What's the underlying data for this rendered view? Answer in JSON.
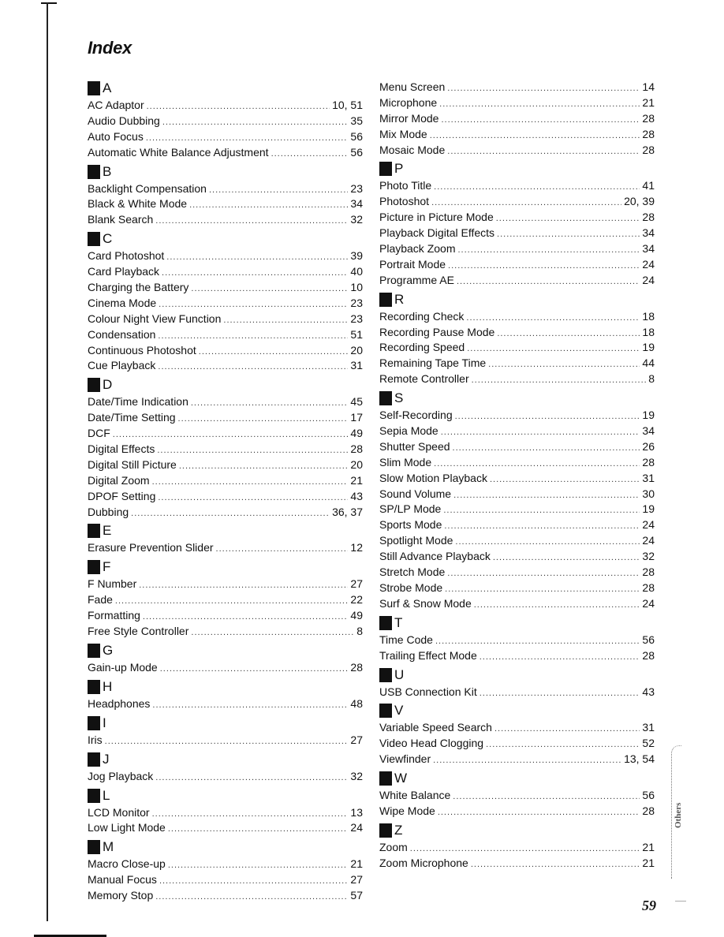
{
  "page": {
    "title": "Index",
    "page_number": "59",
    "side_tab_label": "Others"
  },
  "left_column": [
    {
      "letter": "A",
      "entries": [
        {
          "term": "AC Adaptor",
          "pages": "10, 51"
        },
        {
          "term": "Audio Dubbing",
          "pages": "35"
        },
        {
          "term": "Auto Focus",
          "pages": "56"
        },
        {
          "term": "Automatic White Balance Adjustment",
          "pages": "56"
        }
      ]
    },
    {
      "letter": "B",
      "entries": [
        {
          "term": "Backlight Compensation",
          "pages": "23"
        },
        {
          "term": "Black & White Mode",
          "pages": "34"
        },
        {
          "term": "Blank Search",
          "pages": "32"
        }
      ]
    },
    {
      "letter": "C",
      "entries": [
        {
          "term": "Card Photoshot",
          "pages": "39"
        },
        {
          "term": "Card Playback",
          "pages": "40"
        },
        {
          "term": "Charging the Battery",
          "pages": "10"
        },
        {
          "term": "Cinema Mode",
          "pages": "23"
        },
        {
          "term": "Colour Night View Function",
          "pages": "23"
        },
        {
          "term": "Condensation",
          "pages": "51"
        },
        {
          "term": "Continuous Photoshot",
          "pages": "20"
        },
        {
          "term": "Cue Playback",
          "pages": "31"
        }
      ]
    },
    {
      "letter": "D",
      "entries": [
        {
          "term": "Date/Time Indication",
          "pages": "45"
        },
        {
          "term": "Date/Time Setting",
          "pages": "17"
        },
        {
          "term": "DCF",
          "pages": "49"
        },
        {
          "term": "Digital Effects",
          "pages": "28"
        },
        {
          "term": "Digital Still Picture",
          "pages": "20"
        },
        {
          "term": "Digital Zoom",
          "pages": "21"
        },
        {
          "term": "DPOF Setting",
          "pages": "43"
        },
        {
          "term": "Dubbing",
          "pages": "36, 37"
        }
      ]
    },
    {
      "letter": "E",
      "entries": [
        {
          "term": "Erasure Prevention Slider",
          "pages": "12"
        }
      ]
    },
    {
      "letter": "F",
      "entries": [
        {
          "term": "F Number",
          "pages": "27"
        },
        {
          "term": "Fade",
          "pages": "22"
        },
        {
          "term": "Formatting",
          "pages": "49"
        },
        {
          "term": "Free Style Controller",
          "pages": "8"
        }
      ]
    },
    {
      "letter": "G",
      "entries": [
        {
          "term": "Gain-up Mode",
          "pages": "28"
        }
      ]
    },
    {
      "letter": "H",
      "entries": [
        {
          "term": "Headphones",
          "pages": "48"
        }
      ]
    },
    {
      "letter": "I",
      "entries": [
        {
          "term": "Iris",
          "pages": "27"
        }
      ]
    },
    {
      "letter": "J",
      "entries": [
        {
          "term": "Jog Playback",
          "pages": "32"
        }
      ]
    },
    {
      "letter": "L",
      "entries": [
        {
          "term": "LCD Monitor",
          "pages": "13"
        },
        {
          "term": "Low Light Mode",
          "pages": "24"
        }
      ]
    },
    {
      "letter": "M",
      "entries": [
        {
          "term": "Macro Close-up",
          "pages": "21"
        },
        {
          "term": "Manual Focus",
          "pages": "27"
        },
        {
          "term": "Memory Stop",
          "pages": "57"
        }
      ]
    }
  ],
  "right_column": [
    {
      "letter": "",
      "entries": [
        {
          "term": "Menu Screen",
          "pages": "14"
        },
        {
          "term": "Microphone",
          "pages": "21"
        },
        {
          "term": "Mirror Mode",
          "pages": "28"
        },
        {
          "term": "Mix Mode",
          "pages": "28"
        },
        {
          "term": "Mosaic Mode",
          "pages": "28"
        }
      ]
    },
    {
      "letter": "P",
      "entries": [
        {
          "term": "Photo Title",
          "pages": "41"
        },
        {
          "term": "Photoshot",
          "pages": "20, 39"
        },
        {
          "term": "Picture in Picture Mode",
          "pages": "28"
        },
        {
          "term": "Playback Digital Effects",
          "pages": "34"
        },
        {
          "term": "Playback Zoom",
          "pages": "34"
        },
        {
          "term": "Portrait Mode",
          "pages": "24"
        },
        {
          "term": "Programme AE",
          "pages": "24"
        }
      ]
    },
    {
      "letter": "R",
      "entries": [
        {
          "term": "Recording Check",
          "pages": "18"
        },
        {
          "term": "Recording Pause Mode",
          "pages": "18"
        },
        {
          "term": "Recording Speed",
          "pages": "19"
        },
        {
          "term": "Remaining Tape Time",
          "pages": "44"
        },
        {
          "term": "Remote Controller",
          "pages": "8"
        }
      ]
    },
    {
      "letter": "S",
      "entries": [
        {
          "term": "Self-Recording",
          "pages": "19"
        },
        {
          "term": "Sepia Mode",
          "pages": "34"
        },
        {
          "term": "Shutter Speed",
          "pages": "26"
        },
        {
          "term": "Slim Mode",
          "pages": "28"
        },
        {
          "term": "Slow Motion Playback",
          "pages": "31"
        },
        {
          "term": "Sound Volume",
          "pages": "30"
        },
        {
          "term": "SP/LP Mode",
          "pages": "19"
        },
        {
          "term": "Sports Mode",
          "pages": "24"
        },
        {
          "term": "Spotlight Mode",
          "pages": "24"
        },
        {
          "term": "Still Advance Playback",
          "pages": "32"
        },
        {
          "term": "Stretch Mode",
          "pages": "28"
        },
        {
          "term": "Strobe Mode",
          "pages": "28"
        },
        {
          "term": "Surf & Snow Mode",
          "pages": "24"
        }
      ]
    },
    {
      "letter": "T",
      "entries": [
        {
          "term": "Time Code",
          "pages": "56"
        },
        {
          "term": "Trailing Effect Mode",
          "pages": "28"
        }
      ]
    },
    {
      "letter": "U",
      "entries": [
        {
          "term": "USB Connection Kit",
          "pages": "43"
        }
      ]
    },
    {
      "letter": "V",
      "entries": [
        {
          "term": "Variable Speed Search",
          "pages": "31"
        },
        {
          "term": "Video Head Clogging",
          "pages": "52"
        },
        {
          "term": "Viewfinder",
          "pages": "13, 54"
        }
      ]
    },
    {
      "letter": "W",
      "entries": [
        {
          "term": "White Balance",
          "pages": "56"
        },
        {
          "term": "Wipe Mode",
          "pages": "28"
        }
      ]
    },
    {
      "letter": "Z",
      "entries": [
        {
          "term": "Zoom",
          "pages": "21"
        },
        {
          "term": "Zoom Microphone",
          "pages": "21"
        }
      ]
    }
  ]
}
